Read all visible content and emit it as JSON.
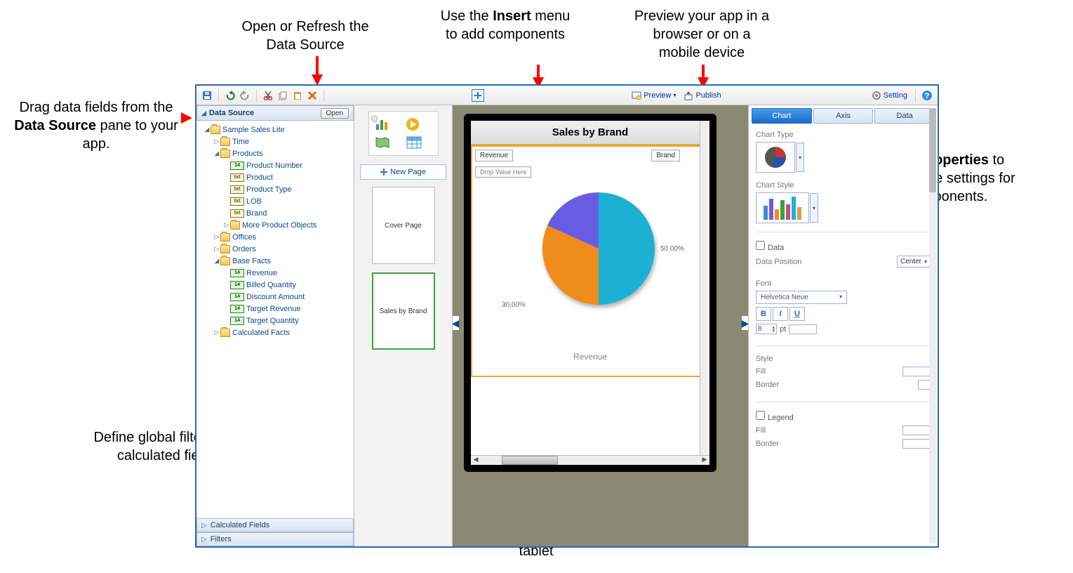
{
  "callouts": {
    "drag_fields": "Drag data fields from the <b>Data Source</b> pane to your app.",
    "open_refresh": "Open or Refresh the Data Source",
    "insert_menu": "Use the <b>Insert</b> menu to add components",
    "preview": "Preview your app in a browser or on a mobile device",
    "properties": "Use <b>Properties</b> to customize settings for components.",
    "filters": "Define global filters and calculated fields",
    "canvas_size": "Design canvas is sized appropriately for phone or tablet"
  },
  "toolbar": {
    "preview": "Preview",
    "publish": "Publish",
    "setting": "Setting"
  },
  "left_panel": {
    "title": "Data Source",
    "open": "Open",
    "root": "Sample Sales Lite",
    "time": "Time",
    "products": "Products",
    "product_number": "Product Number",
    "product": "Product",
    "product_type": "Product Type",
    "lob": "LOB",
    "brand": "Brand",
    "more_products": "More Product Objects",
    "offices": "Offices",
    "orders": "Orders",
    "base_facts": "Base Facts",
    "revenue": "Revenue",
    "billed_qty": "Billed Quantity",
    "discount": "Discount Amount",
    "target_rev": "Target Revenue",
    "target_qty": "Target Quantity",
    "calc_facts": "Calculated Facts",
    "calc_fields": "Calculated Fields",
    "filters": "Filters"
  },
  "pages": {
    "new_page": "New Page",
    "cover": "Cover Page",
    "sales_brand": "Sales by Brand"
  },
  "canvas": {
    "title": "Sales by Brand",
    "y_label": "Revenue",
    "x_label": "Brand",
    "drop_hint": "Drop Value Here",
    "axis_caption": "Revenue"
  },
  "right_panel": {
    "tab_chart": "Chart",
    "tab_axis": "Axis",
    "tab_data": "Data",
    "chart_type": "Chart Type",
    "chart_style": "Chart Style",
    "data_section": "Data",
    "data_position": "Data Position",
    "data_position_val": "Center",
    "font_section": "Font",
    "font_family": "Helvetica Neue",
    "font_size": "8",
    "font_unit": "pt",
    "style_section": "Style",
    "fill": "Fill",
    "border": "Border",
    "legend_section": "Legend",
    "legend_fill": "Fill",
    "legend_border": "Border"
  },
  "chart_data": {
    "type": "pie",
    "title": "Sales by Brand",
    "value_field": "Revenue",
    "category_field": "Brand",
    "slices": [
      {
        "label": "50.00%",
        "value": 50,
        "color": "#1fb0d2"
      },
      {
        "label": "30.00%",
        "value": 30,
        "color": "#f08c1a"
      },
      {
        "label": "",
        "value": 20,
        "color": "#6b5ce0"
      }
    ]
  }
}
